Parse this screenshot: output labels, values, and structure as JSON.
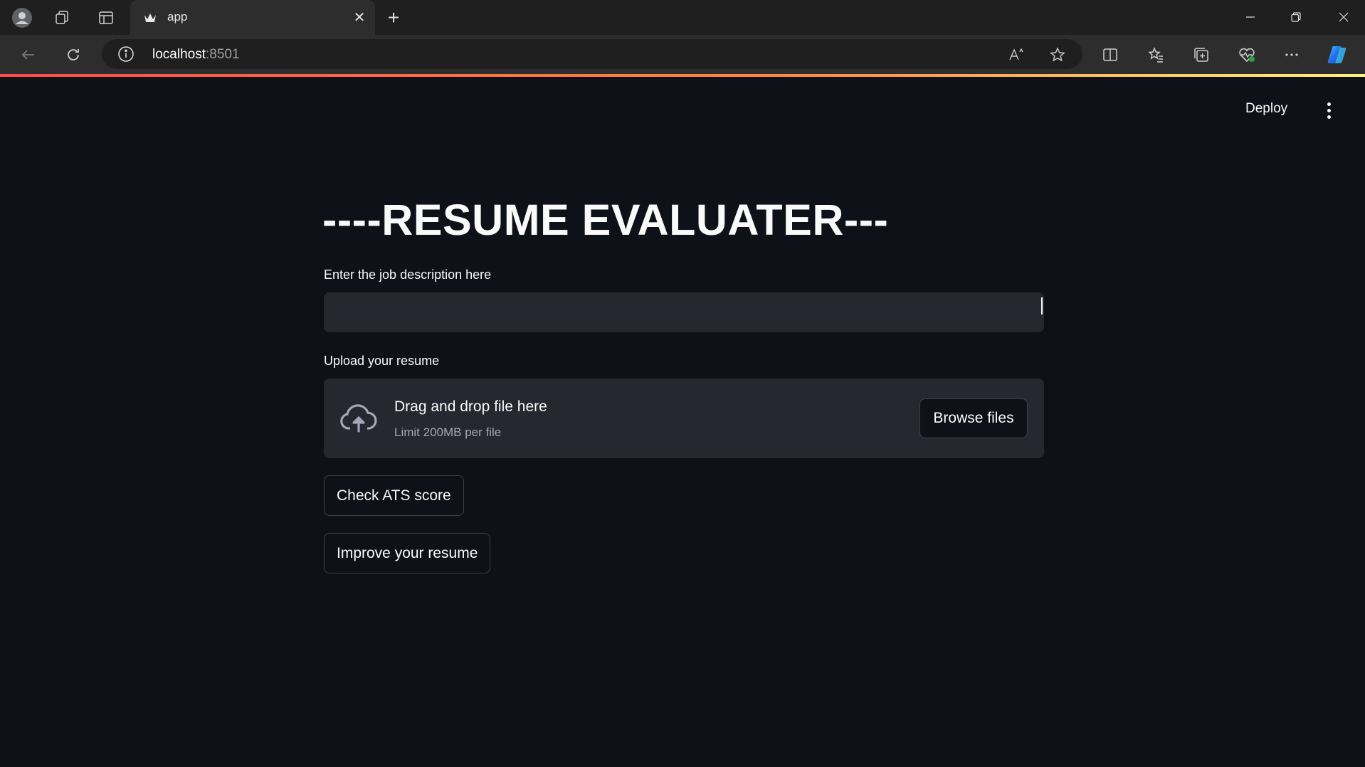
{
  "browser": {
    "tab_title": "app",
    "tab_close": "✕",
    "new_tab": "+",
    "url_host": "localhost",
    "url_port": ":8501"
  },
  "app": {
    "deploy_label": "Deploy",
    "title": "----RESUME EVALUATER---",
    "job_description": {
      "label": "Enter the job description here",
      "value": "",
      "placeholder": ""
    },
    "uploader": {
      "label": "Upload your resume",
      "drag_text": "Drag and drop file here",
      "limit_text": "Limit 200MB per file",
      "browse_label": "Browse files"
    },
    "buttons": {
      "check_ats": "Check ATS score",
      "improve": "Improve your resume"
    }
  },
  "colors": {
    "background": "#0e1117",
    "widget_bg": "#262730",
    "text": "#fafafa",
    "accent_gradient_start": "#ff4b4b",
    "accent_gradient_end": "#fff27a"
  }
}
